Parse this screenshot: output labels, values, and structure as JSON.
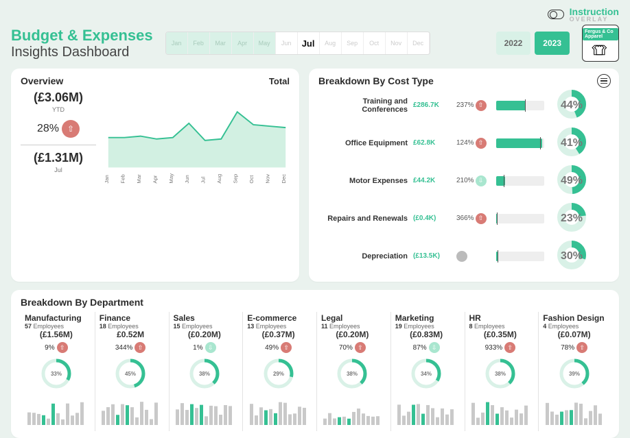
{
  "brand": {
    "name": "Instruction",
    "sub": "OVERLAY"
  },
  "title": {
    "line1": "Budget & Expenses",
    "line2": "Insights Dashboard"
  },
  "months": [
    "Jan",
    "Feb",
    "Mar",
    "Apr",
    "May",
    "Jun",
    "Jul",
    "Aug",
    "Sep",
    "Oct",
    "Nov",
    "Dec"
  ],
  "selected_month": "Jul",
  "disabled_upto": 5,
  "years": [
    "2022",
    "2023"
  ],
  "selected_year": "2023",
  "logo_label": "Fergus & Co Apparel",
  "watermark": {
    "month": "July",
    "year": "2023"
  },
  "overview": {
    "title": "Overview",
    "right_label": "Total",
    "ytd_value": "(£3.06M)",
    "ytd_label": "YTD",
    "pct": "28%",
    "pct_dir": "up",
    "month_value": "(£1.31M)",
    "month_label": "Jul",
    "x_labels": [
      "Jan",
      "Feb",
      "Mar",
      "Apr",
      "May",
      "Jun",
      "Jul",
      "Aug",
      "Sep",
      "Oct",
      "Nov",
      "Dec"
    ]
  },
  "costs": {
    "title": "Breakdown By Cost Type",
    "rows": [
      {
        "name": "Training and Conferences",
        "amount": "£286.7K",
        "pct": "237%",
        "dir": "up",
        "bar": 0.62,
        "mark": 0.6,
        "ring": 44
      },
      {
        "name": "Office Equipment",
        "amount": "£62.8K",
        "pct": "124%",
        "dir": "up",
        "bar": 0.95,
        "mark": 0.92,
        "ring": 41
      },
      {
        "name": "Motor Expenses",
        "amount": "£44.2K",
        "pct": "210%",
        "dir": "down",
        "bar": 0.18,
        "mark": 0.16,
        "ring": 49
      },
      {
        "name": "Repairs and Renewals",
        "amount": "(£0.4K)",
        "pct": "366%",
        "dir": "up",
        "bar": 0.02,
        "mark": 0.02,
        "ring": 23
      },
      {
        "name": "Depreciation",
        "amount": "(£13.5K)",
        "pct": "",
        "dir": "neutral",
        "bar": 0.03,
        "mark": 0.03,
        "ring": 30
      }
    ]
  },
  "depts": {
    "title": "Breakdown By Department",
    "items": [
      {
        "name": "Manufacturing",
        "emp": 57,
        "val": "(£1.56M)",
        "pct": "9%",
        "dir": "up",
        "ring": 33
      },
      {
        "name": "Finance",
        "emp": 18,
        "val": "£0.52M",
        "pct": "344%",
        "dir": "up",
        "ring": 45
      },
      {
        "name": "Sales",
        "emp": 15,
        "val": "(£0.20M)",
        "pct": "1%",
        "dir": "down",
        "ring": 38
      },
      {
        "name": "E-commerce",
        "emp": 13,
        "val": "(£0.37M)",
        "pct": "49%",
        "dir": "up",
        "ring": 29
      },
      {
        "name": "Legal",
        "emp": 11,
        "val": "(£0.20M)",
        "pct": "70%",
        "dir": "up",
        "ring": 38
      },
      {
        "name": "Marketing",
        "emp": 19,
        "val": "(£0.83M)",
        "pct": "87%",
        "dir": "down",
        "ring": 34
      },
      {
        "name": "HR",
        "emp": 8,
        "val": "(£0.35M)",
        "pct": "933%",
        "dir": "up",
        "ring": 38
      },
      {
        "name": "Fashion Design",
        "emp": 4,
        "val": "(£0.07M)",
        "pct": "78%",
        "dir": "up",
        "ring": 39
      }
    ],
    "emp_label": "Employees"
  },
  "chart_data": {
    "type": "area",
    "title": "Overview Total",
    "x": [
      "Jan",
      "Feb",
      "Mar",
      "Apr",
      "May",
      "Jun",
      "Jul",
      "Aug",
      "Sep",
      "Oct",
      "Nov",
      "Dec"
    ],
    "series": [
      {
        "name": "Total",
        "values": [
          0.42,
          0.42,
          0.44,
          0.4,
          0.42,
          0.62,
          0.38,
          0.4,
          0.78,
          0.6,
          0.58,
          0.56
        ]
      }
    ],
    "ylim": [
      0,
      1
    ],
    "xlabel": "",
    "ylabel": ""
  }
}
